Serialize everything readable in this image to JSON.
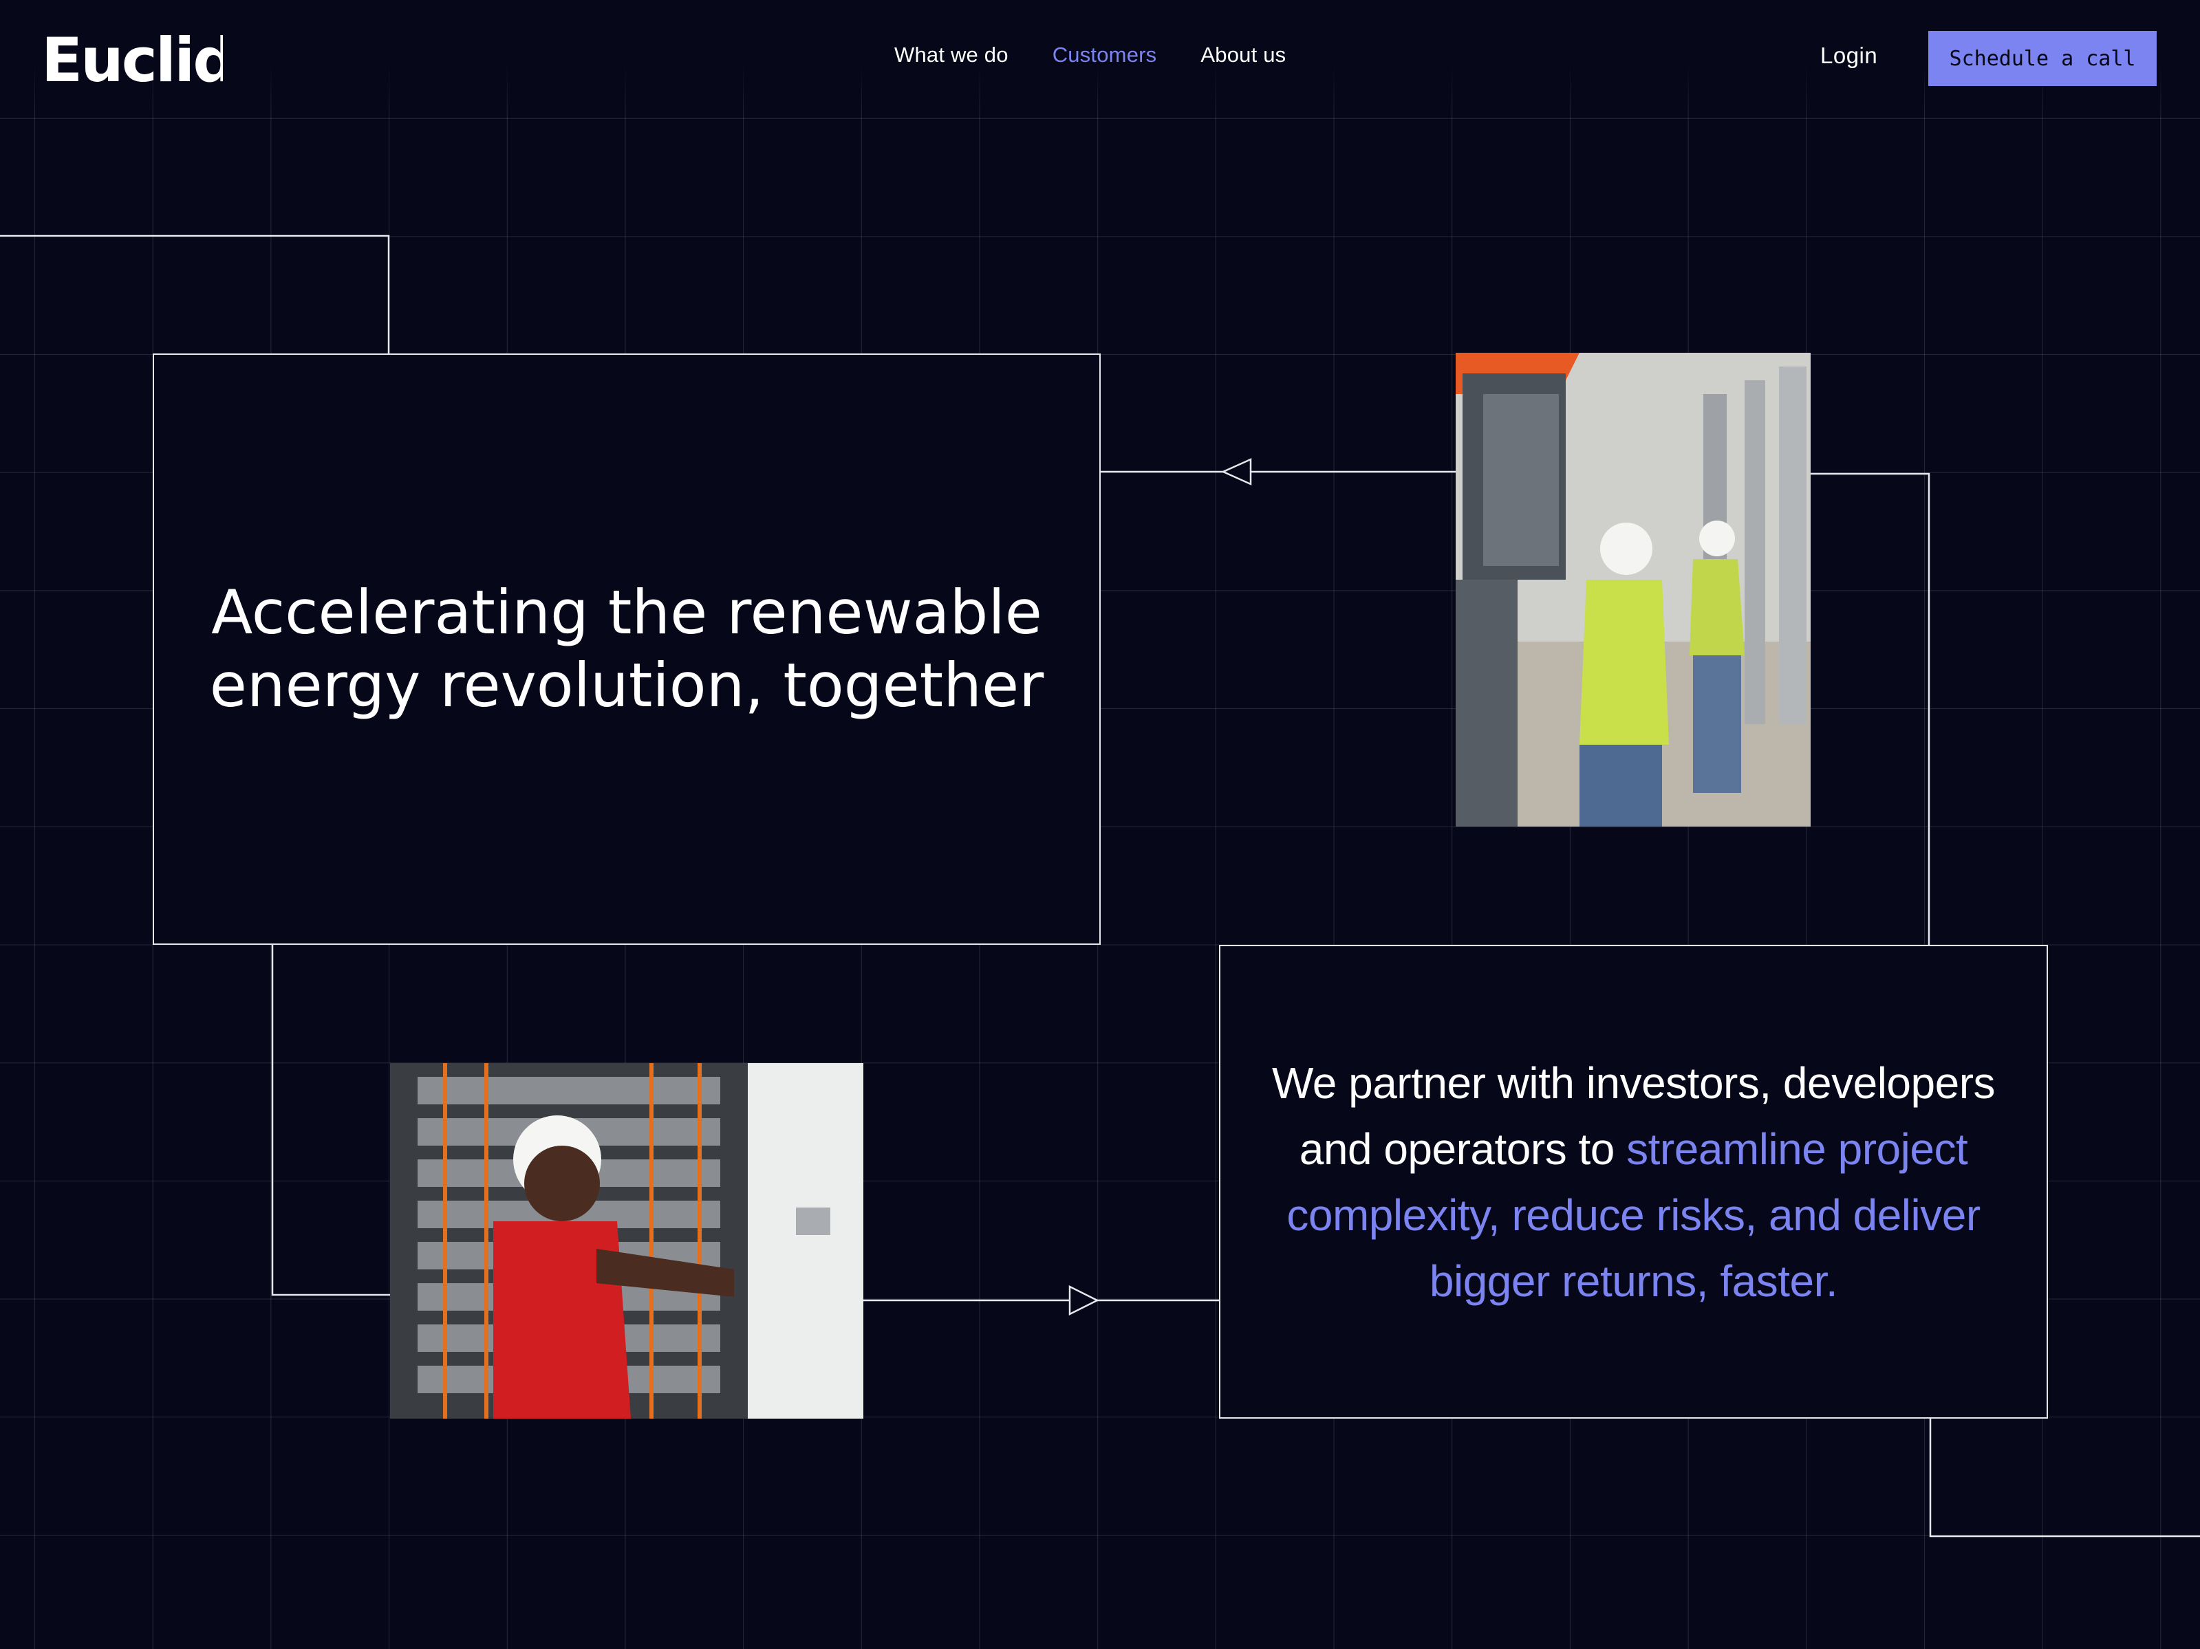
{
  "brand": {
    "logo_text": "Euclid"
  },
  "nav": {
    "items": [
      {
        "label": "What we do",
        "active": false
      },
      {
        "label": "Customers",
        "active": true
      },
      {
        "label": "About us",
        "active": false
      }
    ]
  },
  "header": {
    "login_label": "Login",
    "cta_label": "Schedule a call"
  },
  "hero": {
    "title": "Accelerating the renewable energy revolution, together"
  },
  "partner": {
    "text_plain": "We partner with investors, developers and operators to ",
    "text_accent": "streamline project complexity, reduce risks, and deliver bigger returns, faster."
  },
  "colors": {
    "background": "#06081a",
    "accent": "#7b84f0",
    "text": "#ffffff",
    "border": "#e7e8ee"
  }
}
